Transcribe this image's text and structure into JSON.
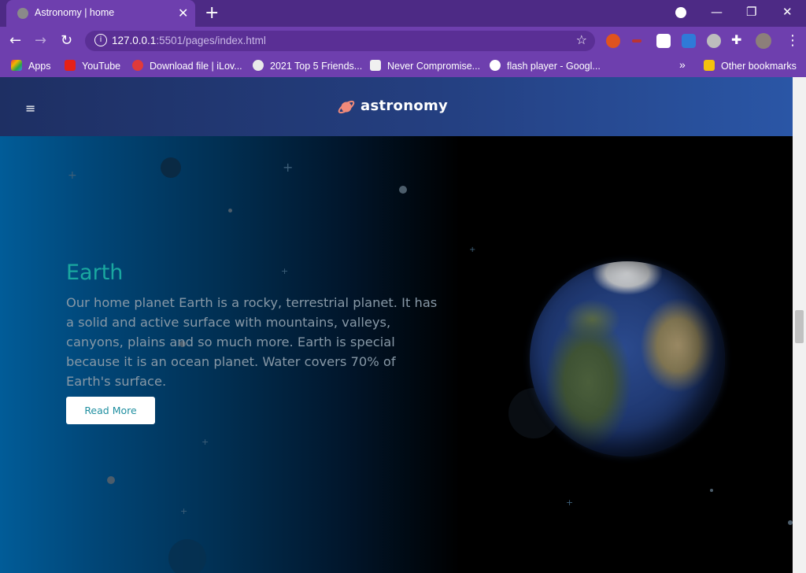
{
  "browser": {
    "tab_title": "Astronomy | home",
    "tab_close": "✕",
    "new_tab": "+",
    "url_host": "127.0.0.1",
    "url_rest": ":5501/pages/index.html",
    "window_controls": [
      "—",
      "❐",
      "✕"
    ]
  },
  "bookmarks": {
    "items": [
      {
        "label": "Apps",
        "icon": "apps-grid-icon"
      },
      {
        "label": "YouTube",
        "icon": "youtube-icon"
      },
      {
        "label": "Download file | iLov...",
        "icon": "heart-icon"
      },
      {
        "label": "2021 Top 5 Friends...",
        "icon": "globe-icon"
      },
      {
        "label": "Never Compromise...",
        "icon": "shield-icon"
      },
      {
        "label": "flash player - Googl...",
        "icon": "google-icon"
      }
    ],
    "overflow": "»",
    "other": "Other bookmarks"
  },
  "site": {
    "logo_text": "astronomy",
    "hero_title": "Earth",
    "hero_text": "Our home planet Earth is a rocky, terrestrial planet. It has a solid and active surface with mountains, valleys, canyons, plains and so much more. Earth is special because it is an ocean planet. Water covers 70% of Earth's surface.",
    "read_more": "Read More"
  },
  "colors": {
    "tab_bar": "#4d2a85",
    "toolbar": "#6e3fae",
    "title_accent": "#1aa8a0",
    "button_text": "#1f8fa0"
  }
}
